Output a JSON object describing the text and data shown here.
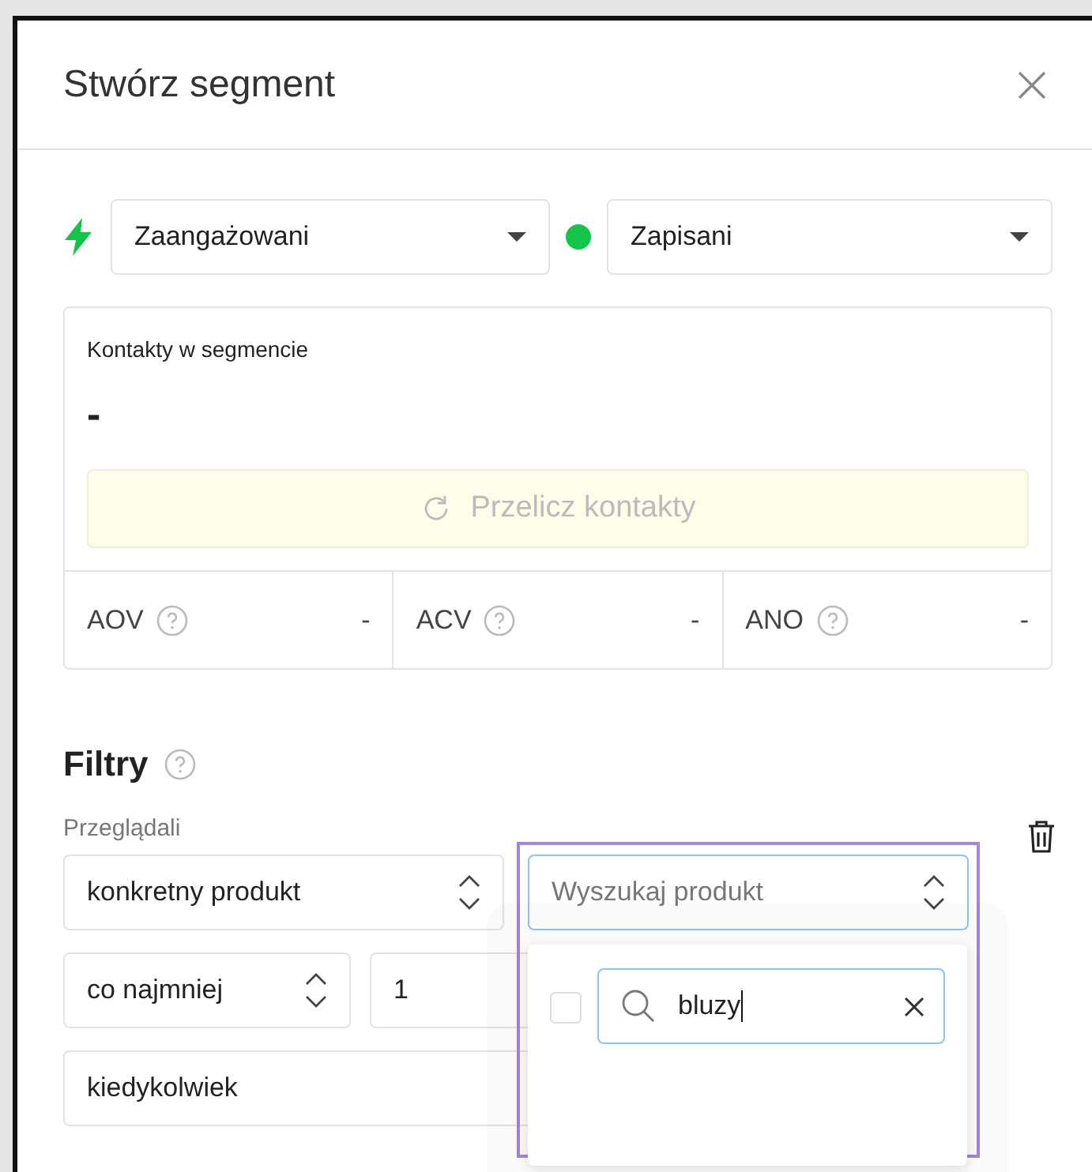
{
  "dialog": {
    "title": "Stwórz segment"
  },
  "segment_selects": [
    {
      "kind": "engagement",
      "value": "Zaangażowani"
    },
    {
      "kind": "status",
      "value": "Zapisani"
    }
  ],
  "contacts": {
    "label": "Kontakty w segmencie",
    "count": "-",
    "recalculate_button": {
      "label": "Przelicz kontakty",
      "disabled": true
    }
  },
  "metrics": [
    {
      "label": "AOV",
      "value": "-"
    },
    {
      "label": "ACV",
      "value": "-"
    },
    {
      "label": "ANO",
      "value": "-"
    }
  ],
  "filters": {
    "title": "Filtry",
    "group_label": "Przeglądali",
    "product_mode": "konkretny produkt",
    "product_search": {
      "placeholder": "Wyszukaj produkt",
      "focused": true
    },
    "quantity_mode": "co najmniej",
    "quantity": "1",
    "time": "kiedykolwiek",
    "dropdown": {
      "checked": false,
      "search_value": "bluzy"
    }
  }
}
